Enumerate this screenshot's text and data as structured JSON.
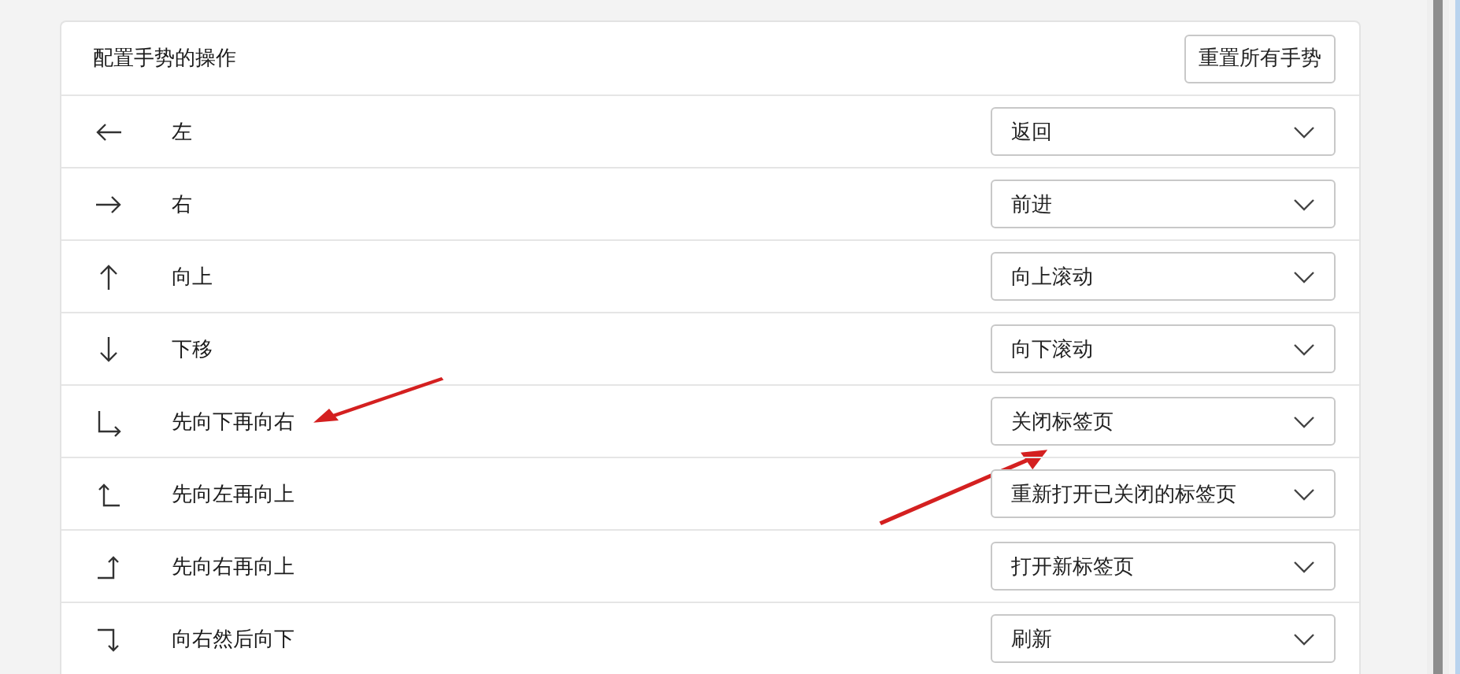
{
  "panel": {
    "title": "配置手势的操作",
    "reset_button": "重置所有手势"
  },
  "rows": [
    {
      "kind": "left",
      "label": "左",
      "action": "返回",
      "marked": false
    },
    {
      "kind": "right",
      "label": "右",
      "action": "前进",
      "marked": false
    },
    {
      "kind": "up",
      "label": "向上",
      "action": "向上滚动",
      "marked": false
    },
    {
      "kind": "down",
      "label": "下移",
      "action": "向下滚动",
      "marked": false
    },
    {
      "kind": "down-right",
      "label": "先向下再向右",
      "action": "关闭标签页",
      "marked": true
    },
    {
      "kind": "left-up",
      "label": "先向左再向上",
      "action": "重新打开已关闭的标签页",
      "marked": false
    },
    {
      "kind": "right-up",
      "label": "先向右再向上",
      "action": "打开新标签页",
      "marked": false
    },
    {
      "kind": "right-down",
      "label": "向右然后向下",
      "action": "刷新",
      "marked": false
    }
  ]
}
